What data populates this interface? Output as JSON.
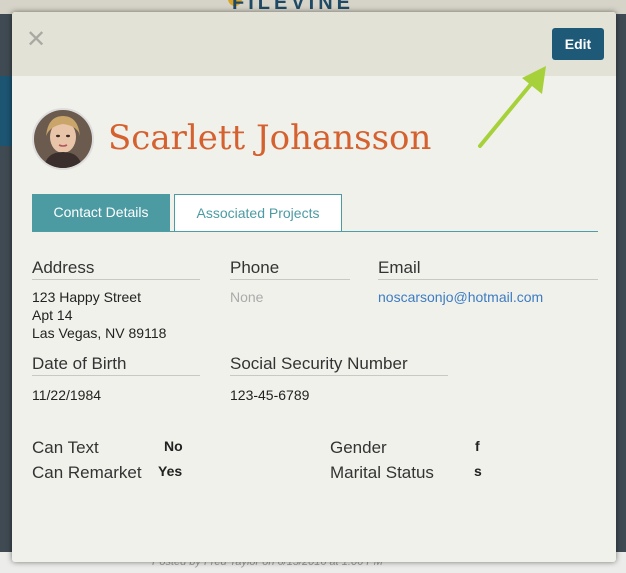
{
  "background": {
    "brand": "FILEVINE",
    "footer_text": "Posted by Fred Taylor on 6/15/2016 at 1:06 PM"
  },
  "modal": {
    "close_icon": "close-icon",
    "edit_label": "Edit",
    "contact_name": "Scarlett Johansson",
    "tabs": [
      {
        "label": "Contact Details",
        "active": true
      },
      {
        "label": "Associated Projects",
        "active": false
      }
    ],
    "address": {
      "label": "Address",
      "line1": "123 Happy Street",
      "line2": "Apt 14",
      "line3": "Las Vegas, NV 89118"
    },
    "phone": {
      "label": "Phone",
      "value": "None"
    },
    "email": {
      "label": "Email",
      "value": "noscarsonjo@hotmail.com"
    },
    "dob": {
      "label": "Date of Birth",
      "value": "11/22/1984"
    },
    "ssn": {
      "label": "Social Security Number",
      "value": "123-45-6789"
    },
    "can_text": {
      "label": "Can Text",
      "value": "No"
    },
    "can_remarket": {
      "label": "Can Remarket",
      "value": "Yes"
    },
    "gender": {
      "label": "Gender",
      "value": "f"
    },
    "marital_status": {
      "label": "Marital Status",
      "value": "s"
    }
  },
  "colors": {
    "accent": "#4c9ba3",
    "name": "#d5612f",
    "edit_button": "#1e5a78",
    "arrow": "#a6d13a"
  }
}
